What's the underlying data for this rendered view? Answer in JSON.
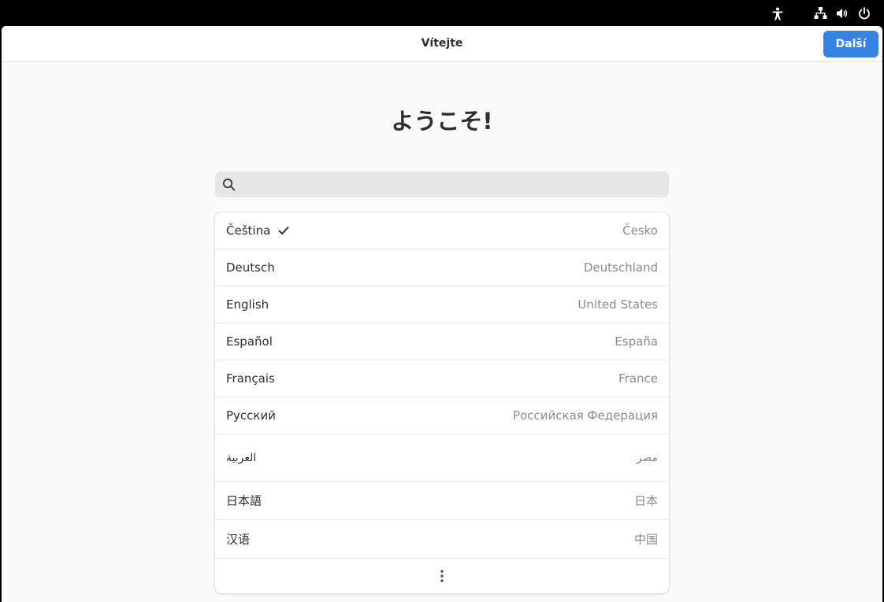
{
  "topbar": {
    "icons": [
      "accessibility-icon",
      "network-wired-icon",
      "volume-icon",
      "power-icon"
    ]
  },
  "header": {
    "title": "Vítejte",
    "next_label": "Další"
  },
  "welcome": {
    "text": "ようこそ!"
  },
  "search": {
    "value": "",
    "placeholder": ""
  },
  "languages": [
    {
      "name": "Čeština",
      "region": "Česko",
      "selected": true
    },
    {
      "name": "Deutsch",
      "region": "Deutschland",
      "selected": false
    },
    {
      "name": "English",
      "region": "United States",
      "selected": false
    },
    {
      "name": "Español",
      "region": "España",
      "selected": false
    },
    {
      "name": "Français",
      "region": "France",
      "selected": false
    },
    {
      "name": "Русский",
      "region": "Российская Федерация",
      "selected": false
    },
    {
      "name": "العربية",
      "region": "مصر",
      "selected": false
    },
    {
      "name": "日本語",
      "region": "日本",
      "selected": false
    },
    {
      "name": "汉语",
      "region": "中国",
      "selected": false
    }
  ],
  "colors": {
    "accent": "#3584e4",
    "window_bg": "#fafafa",
    "topbar_bg": "#000000"
  }
}
